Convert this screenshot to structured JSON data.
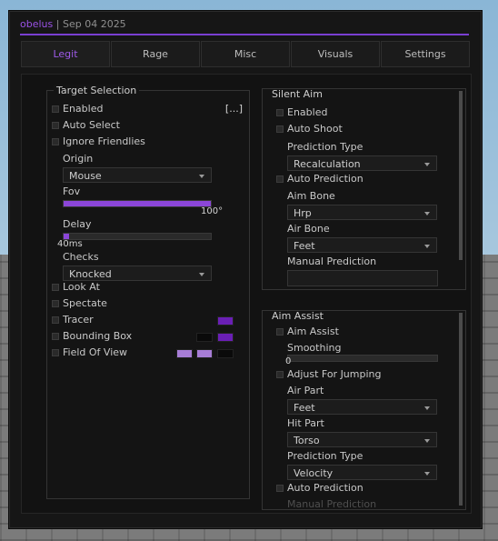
{
  "header": {
    "brand": "obelus",
    "separator": "|",
    "date": "Sep 04 2025",
    "accent_color": "#7a3fd1"
  },
  "tabs": [
    {
      "label": "Legit",
      "active": true
    },
    {
      "label": "Rage"
    },
    {
      "label": "Misc"
    },
    {
      "label": "Visuals"
    },
    {
      "label": "Settings"
    }
  ],
  "target_selection": {
    "title": "Target Selection",
    "enabled_label": "Enabled",
    "keybind": "[...]",
    "auto_select_label": "Auto Select",
    "ignore_friendlies_label": "Ignore Friendlies",
    "origin_label": "Origin",
    "origin_value": "Mouse",
    "fov_label": "Fov",
    "fov_value": "100°",
    "fov_fraction": 1.0,
    "delay_label": "Delay",
    "delay_value": "40ms",
    "delay_fraction": 0.04,
    "checks_label": "Checks",
    "checks_value": "Knocked",
    "look_at_label": "Look At",
    "spectate_label": "Spectate",
    "tracer_label": "Tracer",
    "tracer_color": "#6a1fb5",
    "bounding_box_label": "Bounding Box",
    "bounding_box_colors": [
      "#0a0a0a",
      "#6a1fb5"
    ],
    "field_of_view_label": "Field Of View",
    "field_of_view_colors": [
      "#a77dd6",
      "#a77dd6",
      "#0a0a0a"
    ]
  },
  "silent_aim": {
    "title": "Silent Aim",
    "enabled_label": "Enabled",
    "auto_shoot_label": "Auto Shoot",
    "prediction_type_label": "Prediction Type",
    "prediction_type_value": "Recalculation",
    "auto_prediction_label": "Auto Prediction",
    "aim_bone_label": "Aim Bone",
    "aim_bone_value": "Hrp",
    "air_bone_label": "Air Bone",
    "air_bone_value": "Feet",
    "manual_prediction_label": "Manual Prediction",
    "manual_prediction_value": ""
  },
  "aim_assist": {
    "title": "Aim Assist",
    "aim_assist_label": "Aim Assist",
    "smoothing_label": "Smoothing",
    "smoothing_value": "0",
    "smoothing_fraction": 0,
    "adjust_for_jumping_label": "Adjust For Jumping",
    "air_part_label": "Air Part",
    "air_part_value": "Feet",
    "hit_part_label": "Hit Part",
    "hit_part_value": "Torso",
    "prediction_type_label": "Prediction Type",
    "prediction_type_value": "Velocity",
    "auto_prediction_label": "Auto Prediction",
    "manual_prediction_label": "Manual Prediction"
  }
}
